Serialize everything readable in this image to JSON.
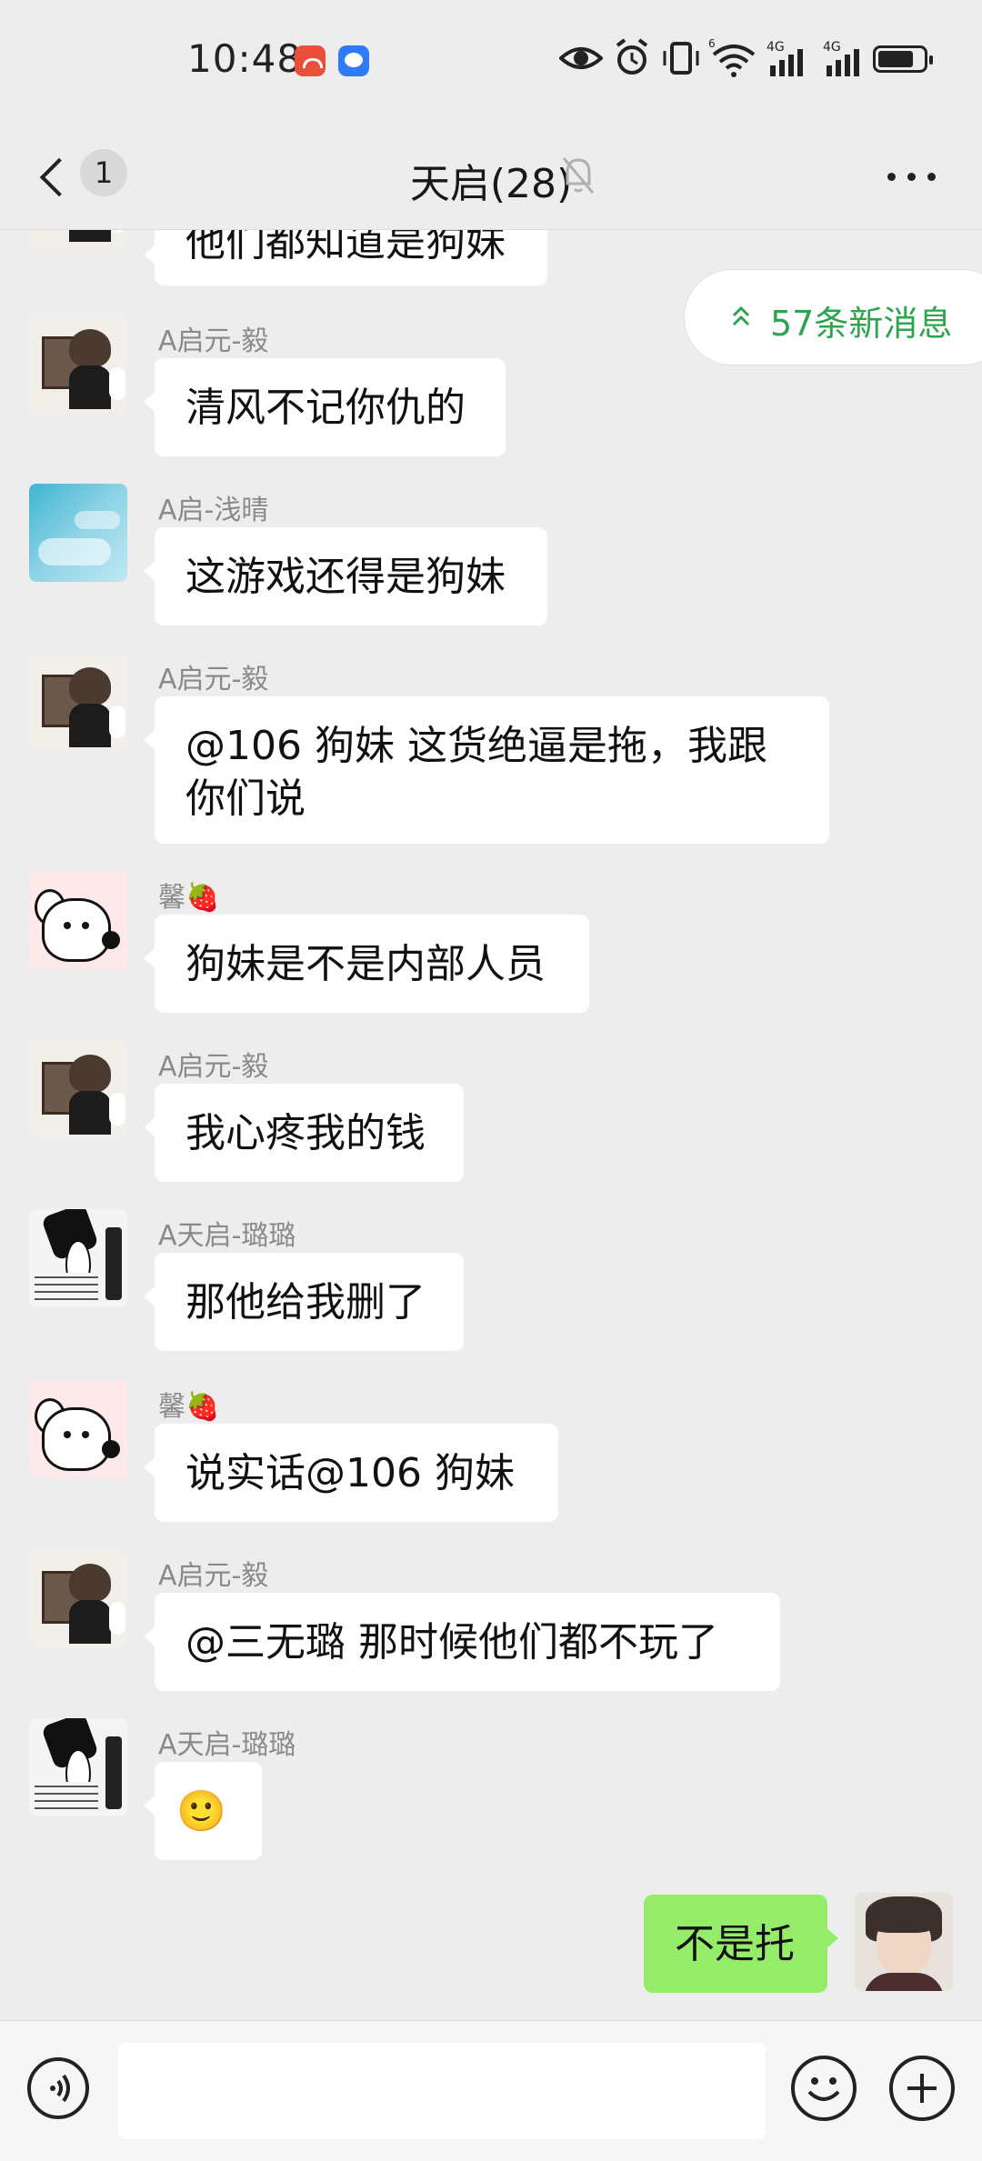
{
  "status_bar": {
    "time": "10:48",
    "network_1": "4G",
    "network_2": "4G",
    "wifi_label": "6"
  },
  "nav": {
    "unread_count": "1",
    "title": "天启(28)"
  },
  "new_messages_pill": {
    "label": "57条新消息"
  },
  "messages": [
    {
      "sender": "",
      "text": "他们都知道是狗妹",
      "avatar": "boy-avatar"
    },
    {
      "sender": "A启元-毅",
      "text": "清风不记你仇的",
      "avatar": "boy-avatar"
    },
    {
      "sender": "A启-浅晴",
      "text": "这游戏还得是狗妹",
      "avatar": "sky-avatar"
    },
    {
      "sender": "A启元-毅",
      "text": "@106 狗妹  这货绝逼是拖，我跟你们说",
      "avatar": "boy-avatar"
    },
    {
      "sender": "馨🍓",
      "text": "狗妹是不是内部人员",
      "avatar": "dog-avatar"
    },
    {
      "sender": "A启元-毅",
      "text": "我心疼我的钱",
      "avatar": "boy-avatar"
    },
    {
      "sender": "A天启-璐璐",
      "text": "那他给我删了",
      "avatar": "manga-avatar"
    },
    {
      "sender": "馨🍓",
      "text": "说实话@106 狗妹",
      "avatar": "dog-avatar"
    },
    {
      "sender": "A启元-毅",
      "text": "@三无璐  那时候他们都不玩了",
      "avatar": "boy-avatar"
    },
    {
      "sender": "A天启-璐璐",
      "text": "🙂",
      "avatar": "manga-avatar"
    },
    {
      "sender": "",
      "text": "不是托",
      "avatar": "self-avatar",
      "outgoing": true
    }
  ],
  "input": {
    "placeholder": "",
    "value": ""
  },
  "colors": {
    "background": "#ededed",
    "outgoing_bubble": "#95ec69",
    "incoming_bubble": "#ffffff",
    "accent_green": "#2ea44f",
    "sender_gray": "#8a8a8a"
  }
}
